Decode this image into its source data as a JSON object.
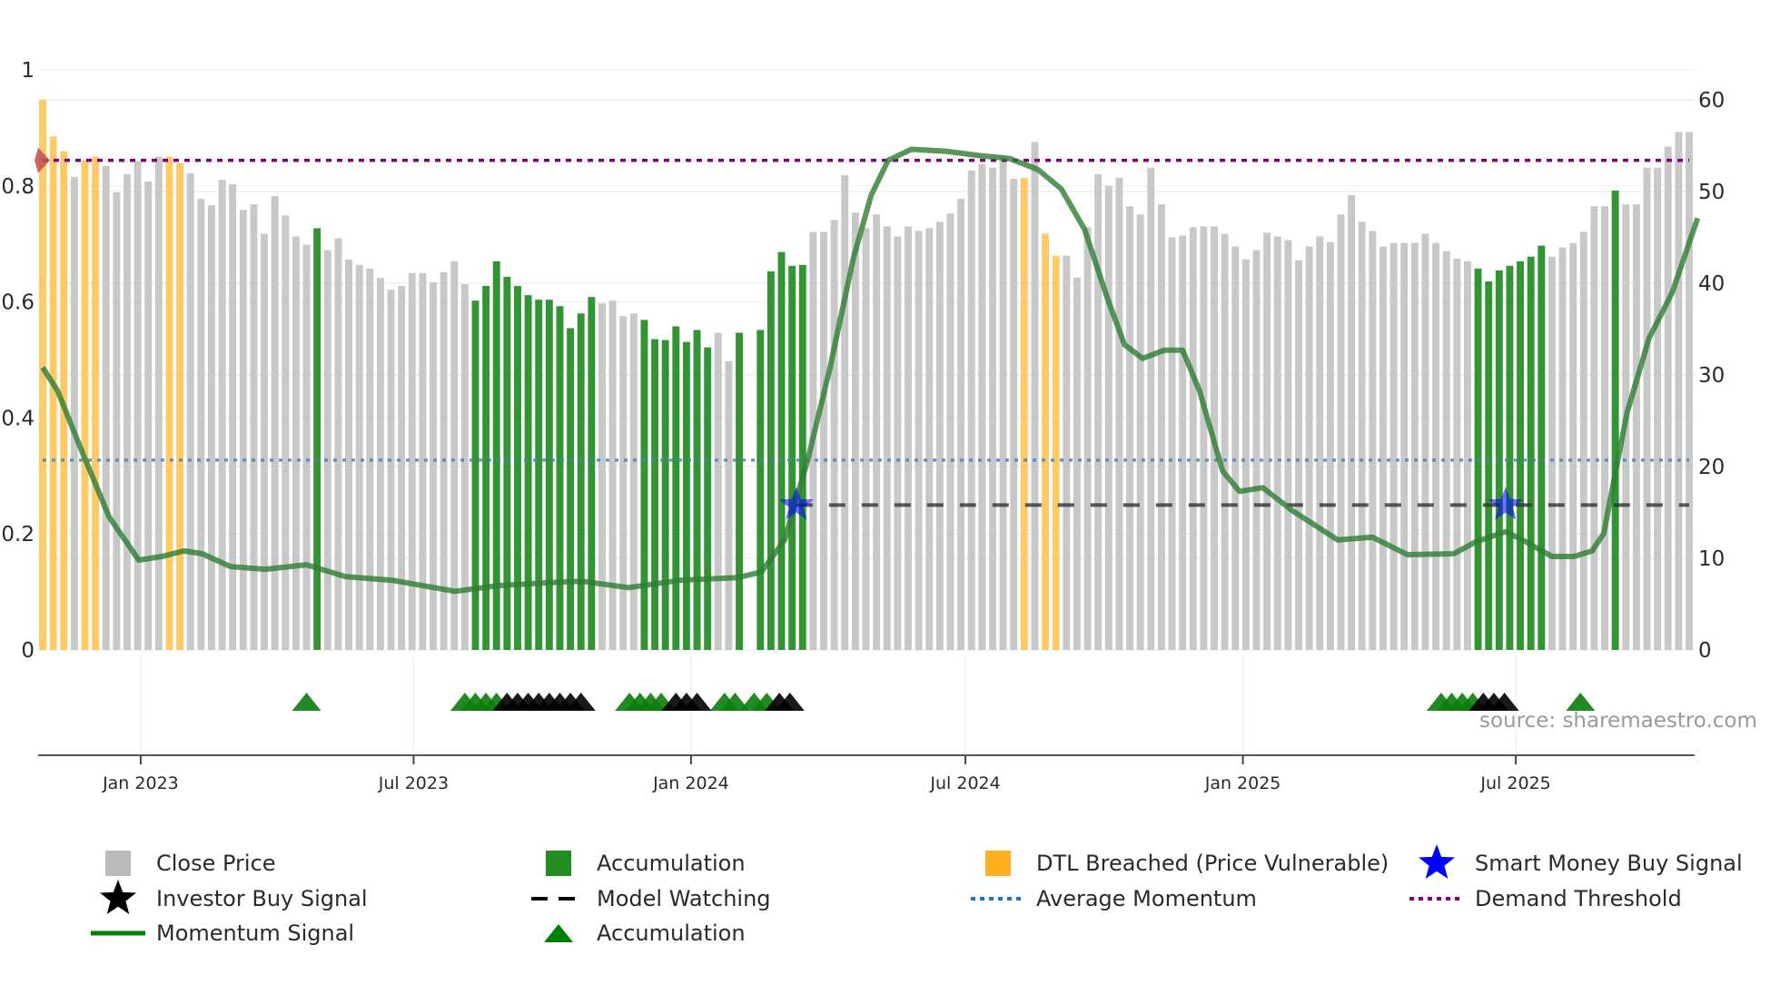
{
  "chart_data": {
    "type": "bar",
    "start_date": "2022-10-28",
    "frequency": "weekly",
    "left_axis": {
      "ticks": [
        0,
        0.2,
        0.4,
        0.6,
        0.8,
        1
      ],
      "labels": [
        "0",
        "0.2",
        "0.4",
        "0.6",
        "0.8",
        "1"
      ],
      "range": [
        0,
        1
      ]
    },
    "right_axis": {
      "ticks": [
        0,
        10,
        20,
        30,
        40,
        50,
        60
      ],
      "labels": [
        "0",
        "10",
        "20",
        "30",
        "40",
        "50",
        "60"
      ],
      "range": [
        0,
        60
      ]
    },
    "x_ticks": [
      {
        "date": "2023-01-01",
        "label": "Jan 2023"
      },
      {
        "date": "2023-07-01",
        "label": "Jul 2023"
      },
      {
        "date": "2024-01-01",
        "label": "Jan 2024"
      },
      {
        "date": "2024-07-01",
        "label": "Jul 2024"
      },
      {
        "date": "2025-01-01",
        "label": "Jan 2025"
      },
      {
        "date": "2025-07-01",
        "label": "Jul 2025"
      }
    ],
    "close_price": [
      60,
      56,
      54.4,
      51.6,
      53.4,
      53.8,
      52.8,
      49.9,
      51.9,
      53.3,
      51.1,
      53.8,
      53.8,
      53.1,
      52,
      49.2,
      48.5,
      51.3,
      50.8,
      48,
      48.6,
      45.4,
      49.5,
      47.4,
      45.1,
      44.2,
      46,
      43.6,
      44.9,
      42.6,
      42,
      41.6,
      40.6,
      39.3,
      39.7,
      41.1,
      41.1,
      40.1,
      41.2,
      42.4,
      39.9,
      38.1,
      39.7,
      42.4,
      40.7,
      39.7,
      38.7,
      38.2,
      38.2,
      37.5,
      35.1,
      36.7,
      38.5,
      37.8,
      38.1,
      36.4,
      36.7,
      36.0,
      33.9,
      33.8,
      35.3,
      33.6,
      34.9,
      33.0,
      34.6,
      31.5,
      34.6,
      null,
      34.9,
      41.3,
      43.4,
      41.9,
      42.0,
      45.6,
      45.6,
      46.9,
      51.8,
      47.7,
      46,
      47.5,
      46.2,
      45.1,
      46.2,
      45.7,
      46,
      46.7,
      47.6,
      49.2,
      52.3,
      53,
      52.6,
      53.8,
      51.4,
      51.5,
      55.4,
      45.4,
      43,
      43,
      40.6,
      46.1,
      51.9,
      50.6,
      51.5,
      48.4,
      47.5,
      52.6,
      48.6,
      45,
      45.2,
      46.1,
      46.2,
      46.2,
      45.4,
      44,
      42.6,
      43.6,
      45.5,
      45.1,
      44.7,
      42.5,
      44,
      45.1,
      44.5,
      47.5,
      49.6,
      46.7,
      45.7,
      44,
      44.4,
      44.4,
      44.4,
      45.4,
      44.4,
      43.5,
      42.7,
      42.4,
      41.6,
      40.2,
      41.4,
      41.9,
      42.4,
      42.9,
      44.1,
      42.9,
      43.9,
      44.4,
      45.6,
      48.4,
      48.4,
      50.1,
      48.6,
      48.6,
      52.6,
      52.6,
      54.9,
      56.5,
      56.5
    ],
    "bar_state": "ooogooggggggooggggggggggggaggggggggggggggaaaaaaaaaaaaggggaaaaaaaggaaaaaaaggggggggggggggggggggogoogggggggggggggggggggggggggggggggggggggggaaaaaaaggggggaggggggggooo",
    "state_key": {
      "g": "Close Price",
      "a": "Accumulation",
      "o": "DTL Breached (Price Vulnerable)"
    },
    "momentum_signal": [
      [
        0,
        30.8
      ],
      [
        1.4,
        28.3
      ],
      [
        3.6,
        22
      ],
      [
        6.3,
        14.5
      ],
      [
        9.1,
        9.8
      ],
      [
        11.3,
        10.2
      ],
      [
        13.4,
        10.8
      ],
      [
        15.1,
        10.5
      ],
      [
        17.8,
        9.1
      ],
      [
        21.1,
        8.8
      ],
      [
        25,
        9.3
      ],
      [
        28.7,
        8
      ],
      [
        33.1,
        7.6
      ],
      [
        39.1,
        6.4
      ],
      [
        43,
        7
      ],
      [
        47.3,
        7.3
      ],
      [
        51.1,
        7.5
      ],
      [
        55.5,
        6.8
      ],
      [
        60.4,
        7.6
      ],
      [
        65.9,
        7.9
      ],
      [
        68.1,
        8.5
      ],
      [
        70.3,
        12
      ],
      [
        72.5,
        20.8
      ],
      [
        74.6,
        30.8
      ],
      [
        76.8,
        42.7
      ],
      [
        78.5,
        49.6
      ],
      [
        80.1,
        53.4
      ],
      [
        82.3,
        54.6
      ],
      [
        85.6,
        54.4
      ],
      [
        88.9,
        53.9
      ],
      [
        91.6,
        53.6
      ],
      [
        94.3,
        52.4
      ],
      [
        96.5,
        50.3
      ],
      [
        98.7,
        45.9
      ],
      [
        100.9,
        38.3
      ],
      [
        102.5,
        33.3
      ],
      [
        104.2,
        31.8
      ],
      [
        106.3,
        32.7
      ],
      [
        108,
        32.7
      ],
      [
        109.6,
        28.3
      ],
      [
        111.8,
        19.5
      ],
      [
        113.4,
        17.3
      ],
      [
        115.6,
        17.7
      ],
      [
        118.4,
        15.2
      ],
      [
        122.7,
        12
      ],
      [
        126,
        12.3
      ],
      [
        129.3,
        10.4
      ],
      [
        133.7,
        10.5
      ],
      [
        135.8,
        11.8
      ],
      [
        138.6,
        12.9
      ],
      [
        140.2,
        12
      ],
      [
        143,
        10.2
      ],
      [
        145.1,
        10.2
      ],
      [
        146.8,
        10.8
      ],
      [
        147.9,
        12.7
      ],
      [
        150.1,
        25.8
      ],
      [
        152.2,
        34
      ],
      [
        154.4,
        39
      ],
      [
        156.8,
        47.1
      ]
    ],
    "average_momentum": 20.7,
    "demand_threshold": 53.4,
    "model_watching": {
      "value": 15.8,
      "from_week": 71.4
    },
    "smart_money_buy_signals": [
      [
        71.4,
        15.8
      ],
      [
        138.6,
        15.8
      ]
    ],
    "accumulation_markers": {
      "green": [
        25,
        40,
        41,
        42,
        43,
        55.6,
        56.6,
        57.6,
        58.6,
        64.6,
        65.6,
        67.4,
        68.6,
        132.5,
        133.5,
        134.5,
        135.5,
        145.7
      ],
      "black": [
        44,
        45,
        46,
        47,
        48,
        49,
        50,
        51,
        60,
        61,
        62,
        69.8,
        70.8,
        136.5,
        137.5,
        138.5
      ]
    },
    "colors": {
      "close": "#c8c8c8",
      "accum": "#228b22",
      "dtl": "#ffc966",
      "momentum": "#2e7d32",
      "avg": "#4682b4",
      "threshold": "#800080",
      "model": "#333333",
      "smart": "#0000ff",
      "start_marker": "#c0504d"
    }
  },
  "source": "source: sharemaestro.com",
  "legend": [
    {
      "label": "Close Price",
      "symbol": "square",
      "color": "#bbbbbb"
    },
    {
      "label": "Accumulation",
      "symbol": "square",
      "color": "#228b22"
    },
    {
      "label": "DTL Breached (Price Vulnerable)",
      "symbol": "square",
      "color": "#ffb020"
    },
    {
      "label": "Smart Money Buy Signal",
      "symbol": "star",
      "color": "#0000ff"
    },
    {
      "label": "Investor Buy Signal",
      "symbol": "star",
      "color": "#000000"
    },
    {
      "label": "Model Watching",
      "symbol": "dash",
      "color": "#000000"
    },
    {
      "label": "Average Momentum",
      "symbol": "dot",
      "color": "#1f77b4"
    },
    {
      "label": "Demand Threshold",
      "symbol": "dot",
      "color": "#800080"
    },
    {
      "label": "Momentum Signal",
      "symbol": "line",
      "color": "#008000"
    },
    {
      "label": "Accumulation",
      "symbol": "triangle",
      "color": "#008000"
    }
  ]
}
